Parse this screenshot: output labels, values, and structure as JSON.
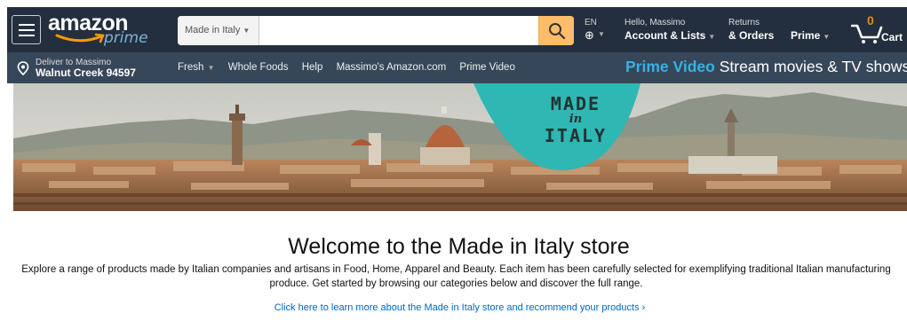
{
  "colors": {
    "nav_dark": "#232f3e",
    "nav_sub": "#37475a",
    "search_button": "#febd69",
    "prime_video_blue": "#34b3e4",
    "cart_count": "#f08804",
    "link_blue": "#0066c0",
    "badge_teal": "#2fb7b3"
  },
  "header": {
    "logo": {
      "word": "amazon",
      "sub": "prime"
    },
    "search": {
      "department": "Made in Italy",
      "placeholder": "",
      "value": ""
    },
    "language": {
      "code": "EN"
    },
    "account": {
      "greeting": "Hello, Massimo",
      "label": "Account & Lists"
    },
    "orders": {
      "line1": "Returns",
      "line2": "& Orders"
    },
    "prime": {
      "label": "Prime"
    },
    "cart": {
      "count": "0",
      "label": "Cart"
    }
  },
  "subnav": {
    "deliver": {
      "line1": "Deliver to Massimo",
      "line2": "Walnut Creek 94597"
    },
    "links": [
      "Fresh",
      "Whole Foods",
      "Help",
      "Massimo's Amazon.com",
      "Prime Video"
    ],
    "promo": {
      "brand": "Prime Video",
      "text": "Stream movies & TV shows"
    }
  },
  "hero": {
    "badge": {
      "line1": "MADE",
      "line2": "in",
      "line3": "ITALY"
    }
  },
  "welcome": {
    "title": "Welcome to the Made in Italy store",
    "body": "Explore a range of products made by Italian companies and artisans in Food, Home, Apparel and Beauty. Each item has been carefully selected for exemplifying traditional Italian manufacturing produce. Get started by browsing our categories below and discover the full range.",
    "cta": "Click here to learn more about the Made in Italy store and recommend your products ›"
  }
}
